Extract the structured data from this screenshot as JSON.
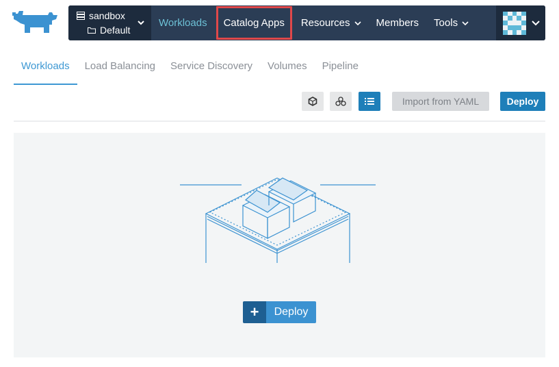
{
  "header": {
    "cluster_name": "sandbox",
    "project_name": "Default",
    "nav": [
      {
        "label": "Workloads"
      },
      {
        "label": "Catalog Apps"
      },
      {
        "label": "Resources"
      },
      {
        "label": "Members"
      },
      {
        "label": "Tools"
      }
    ]
  },
  "tabs": [
    "Workloads",
    "Load Balancing",
    "Service Discovery",
    "Volumes",
    "Pipeline"
  ],
  "toolbar": {
    "import_label": "Import from YAML",
    "deploy_label": "Deploy"
  },
  "empty_state": {
    "deploy_label": "Deploy",
    "plus": "+"
  },
  "colors": {
    "nav_bg": "#2b3d55",
    "nav_dark": "#1d2b3d",
    "accent": "#1e7fb9",
    "active_nav": "#6dc1d6",
    "highlight_box": "#e0484a",
    "tab_active": "#3d98d3",
    "logo": "#3b92d1"
  },
  "icons": {
    "logo": "rancher-cow-logo",
    "cluster": "server-icon",
    "project": "folder-icon",
    "view_node": "hexagon-icon",
    "view_group": "cluster-icon",
    "view_list": "list-icon"
  }
}
